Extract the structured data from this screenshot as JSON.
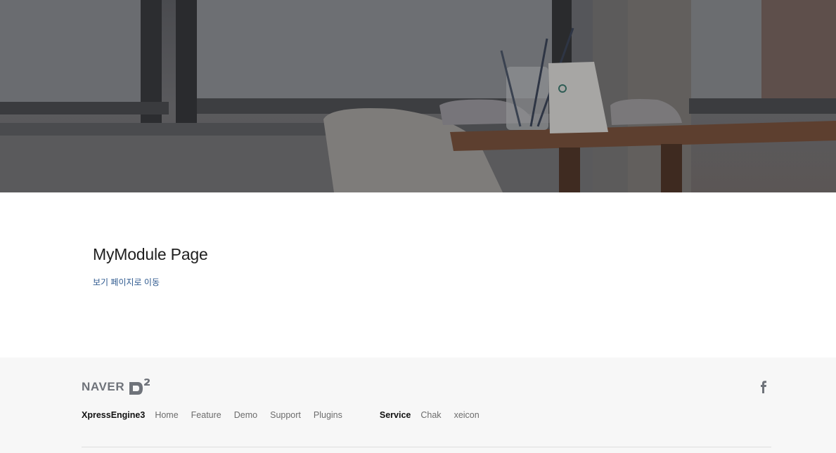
{
  "content": {
    "title": "MyModule Page",
    "view_link": "보기 페이지로 이동",
    "link_color": "#2f5a8f"
  },
  "footer": {
    "brand": {
      "word": "NAVER",
      "logo_text": "D2",
      "color": "#6f737a"
    },
    "social_icon": "facebook-icon",
    "nav_groups": [
      {
        "heading": "XpressEngine3",
        "links": [
          "Home",
          "Feature",
          "Demo",
          "Support",
          "Plugins"
        ]
      },
      {
        "heading": "Service",
        "links": [
          "Chak",
          "xeicon"
        ]
      }
    ]
  }
}
